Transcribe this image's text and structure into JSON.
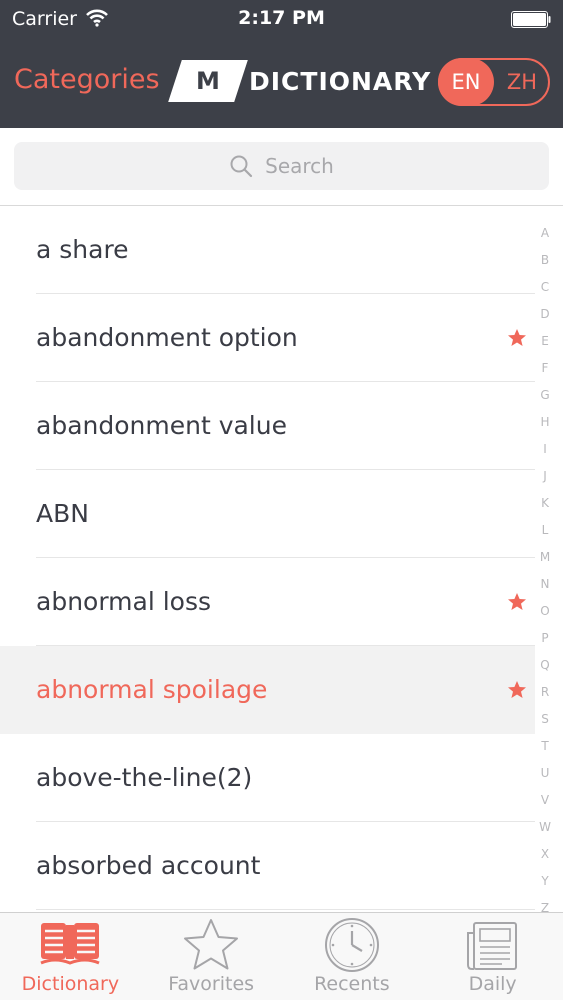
{
  "status_bar": {
    "carrier": "Carrier",
    "time": "2:17 PM"
  },
  "header": {
    "categories_label": "Categories",
    "logo_mark": "M",
    "logo_word": "DICTIONARY",
    "lang_en": "EN",
    "lang_zh": "ZH",
    "active_lang": "EN"
  },
  "search": {
    "placeholder": "Search"
  },
  "words": [
    {
      "label": "a share",
      "favorite": false,
      "selected": false
    },
    {
      "label": "abandonment option",
      "favorite": true,
      "selected": false
    },
    {
      "label": "abandonment value",
      "favorite": false,
      "selected": false
    },
    {
      "label": "ABN",
      "favorite": false,
      "selected": false
    },
    {
      "label": "abnormal loss",
      "favorite": true,
      "selected": false
    },
    {
      "label": "abnormal spoilage",
      "favorite": true,
      "selected": true
    },
    {
      "label": "above-the-line(2)",
      "favorite": false,
      "selected": false
    },
    {
      "label": "absorbed account",
      "favorite": false,
      "selected": false
    }
  ],
  "alpha_index": [
    "A",
    "B",
    "C",
    "D",
    "E",
    "F",
    "G",
    "H",
    "I",
    "J",
    "K",
    "L",
    "M",
    "N",
    "O",
    "P",
    "Q",
    "R",
    "S",
    "T",
    "U",
    "V",
    "W",
    "X",
    "Y",
    "Z"
  ],
  "tabs": [
    {
      "label": "Dictionary",
      "icon": "book-icon",
      "active": true
    },
    {
      "label": "Favorites",
      "icon": "star-icon",
      "active": false
    },
    {
      "label": "Recents",
      "icon": "clock-icon",
      "active": false
    },
    {
      "label": "Daily",
      "icon": "newspaper-icon",
      "active": false
    }
  ],
  "colors": {
    "accent": "#f0685a",
    "header_bg": "#3d4048",
    "text": "#3a3c45",
    "muted": "#a5a5a8"
  }
}
